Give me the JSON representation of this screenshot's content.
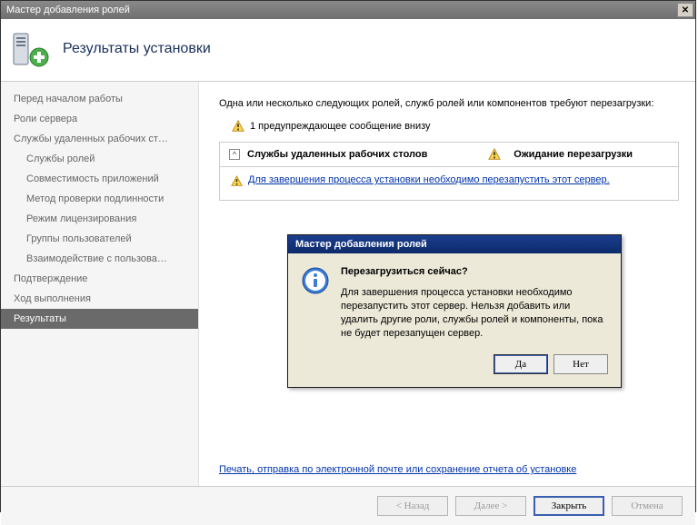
{
  "window": {
    "title": "Мастер добавления ролей"
  },
  "header": {
    "title": "Результаты установки"
  },
  "sidebar": {
    "items": [
      {
        "label": "Перед началом работы"
      },
      {
        "label": "Роли сервера"
      },
      {
        "label": "Службы удаленных рабочих ст…"
      },
      {
        "label": "Службы ролей"
      },
      {
        "label": "Совместимость приложений"
      },
      {
        "label": "Метод проверки подлинности"
      },
      {
        "label": "Режим лицензирования"
      },
      {
        "label": "Группы пользователей"
      },
      {
        "label": "Взаимодействие с пользова…"
      },
      {
        "label": "Подтверждение"
      },
      {
        "label": "Ход выполнения"
      },
      {
        "label": "Результаты"
      }
    ]
  },
  "main": {
    "intro": "Одна или несколько следующих ролей, служб ролей или компонентов требуют перезагрузки:",
    "warning_count": "1 предупреждающее сообщение внизу",
    "group_title": "Службы удаленных рабочих столов",
    "group_status": "Ожидание перезагрузки",
    "group_msg": "Для завершения процесса установки необходимо перезапустить этот сервер.",
    "report_link": "Печать, отправка по электронной почте или сохранение отчета об установке"
  },
  "dialog": {
    "title": "Мастер добавления ролей",
    "heading": "Перезагрузиться сейчас?",
    "message": "Для завершения процесса установки необходимо перезапустить этот сервер. Нельзя добавить или удалить другие роли, службы ролей и компоненты, пока не будет перезапущен сервер.",
    "yes": "Да",
    "no": "Нет"
  },
  "footer": {
    "back": "< Назад",
    "next": "Далее >",
    "close": "Закрыть",
    "cancel": "Отмена"
  }
}
